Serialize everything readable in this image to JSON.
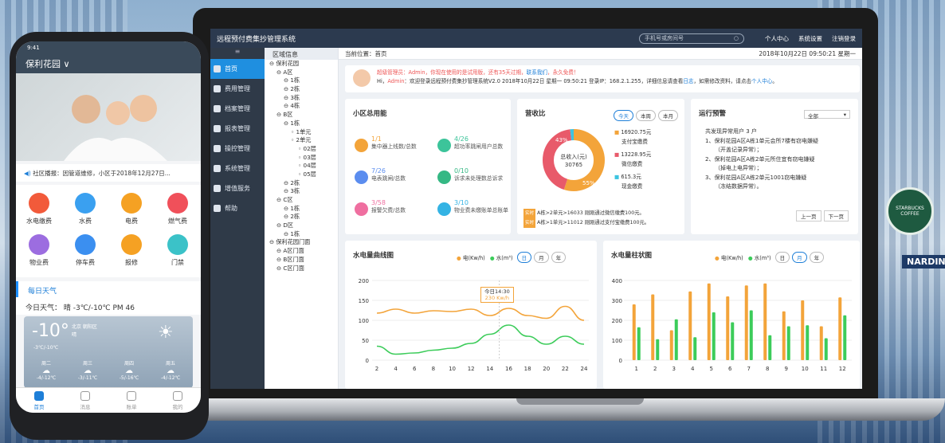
{
  "laptop": {
    "app_title": "远程预付费集抄管理系统",
    "search_placeholder": "手机号或房间号",
    "top_links": [
      "个人中心",
      "系统设置",
      "注销登录"
    ],
    "collapse": "≡",
    "nav": [
      "首页",
      "费用管理",
      "档案管理",
      "报表管理",
      "操控管理",
      "系统管理",
      "增值服务",
      "帮助"
    ],
    "tree_header": "区域信息",
    "tree": [
      "保利花园",
      "A区",
      "1栋",
      "2栋",
      "3栋",
      "4栋",
      "B区",
      "1栋",
      "1单元",
      "2单元",
      "02层",
      "03层",
      "04层",
      "05层",
      "2栋",
      "3栋",
      "C区",
      "1栋",
      "2栋",
      "D区",
      "1栋",
      "保利花园门面",
      "A区门面",
      "B区门面",
      "C区门面"
    ],
    "crumb": "当前位置：首页",
    "datetime": "2018年10月22日    09:50:21    星期一",
    "welcome_line1_a": "超级管理员：Admin，你现在使用的是试用版，还有35天过期，",
    "welcome_line1_b": "联系我们",
    "welcome_line1_c": "，永久免费！",
    "welcome_line2_a": "Hi，",
    "welcome_line2_b": "Admin",
    "welcome_line2_c": "：欢迎登录远程预付费集抄管理系统V2.0    2018年10月22日    星期一    09:50:21    登录IP：168.2.1.255，详细信息请查看",
    "welcome_line2_d": "日志",
    "welcome_line2_e": "，如需修改资料，请点击",
    "welcome_line2_f": "个人中心",
    "welcome_line2_g": "。",
    "energy": {
      "title": "小区总用能",
      "stats": [
        {
          "value": "1/1",
          "label": "集中器上线数/总数",
          "color": "#f3a43a"
        },
        {
          "value": "4/26",
          "label": "超功率跳闸用户总数",
          "color": "#3cc49a"
        },
        {
          "value": "7/26",
          "label": "电表跳闸/总数",
          "color": "#5b8def"
        },
        {
          "value": "0/10",
          "label": "诉求未处理数总诉求",
          "color": "#35b884"
        },
        {
          "value": "3/58",
          "label": "报警欠费/总数",
          "color": "#ef6fa0"
        },
        {
          "value": "3/10",
          "label": "物业费未缴账单总账单",
          "color": "#34b3e4"
        }
      ]
    },
    "revenue": {
      "title": "营收比",
      "tabs": [
        "今天",
        "本周",
        "本月"
      ],
      "center_label": "总收入(元)",
      "center_value": "30765",
      "pct_a": "43%",
      "pct_b": "55%",
      "items": [
        {
          "value": "16920.75元",
          "label": "支付宝缴费",
          "color": "#f3a43a"
        },
        {
          "value": "13228.95元",
          "label": "微信缴费",
          "color": "#e85a6a"
        },
        {
          "value": "615.3元",
          "label": "现金缴费",
          "color": "#3cc4e0"
        }
      ],
      "tag": "实时",
      "news": [
        "A栋>2单元>16033 刚刚通过微信缴费100元。",
        "A栋>1单元>11012 刚刚通过支付宝缴费100元。"
      ]
    },
    "alert": {
      "title": "运行预警",
      "select": "全部",
      "summary": "共发现异常用户 3 户",
      "items": [
        "1、保利花园A区A栋1单元会所7楼有窃电嫌疑",
        "（开盖记录异常）；",
        "2、保利花园A区A栋2单元所住宜有窃电嫌疑",
        "（掉电上电异常）；",
        "3、保利花园A区A栋2单元1001窃电嫌疑",
        "（冻结数据异常）。"
      ],
      "prev": "上一页",
      "next": "下一页"
    },
    "line_chart": {
      "title": "水电量曲线图",
      "legend_e": "电(Kw/h)",
      "legend_w": "水(m³)",
      "tabs": [
        "日",
        "月",
        "年"
      ],
      "tip_time": "今日14:30",
      "tip_value": "230 Kw/h"
    },
    "bar_chart": {
      "title": "水电量柱状图",
      "legend_e": "电(Kw/h)",
      "legend_w": "水(m³)",
      "tabs": [
        "日",
        "月",
        "年"
      ]
    },
    "colors": {
      "electric": "#f3a43a",
      "water": "#3ccc5a",
      "accent": "#1e7fd8"
    }
  },
  "chart_data": [
    {
      "type": "line",
      "title": "水电量曲线图",
      "x": [
        2,
        4,
        6,
        8,
        10,
        12,
        14,
        16,
        18,
        20,
        22,
        24
      ],
      "ylim": [
        0,
        200
      ],
      "yticks": [
        0,
        50,
        100,
        150,
        200
      ],
      "series": [
        {
          "name": "电(Kw/h)",
          "values": [
            118,
            128,
            118,
            124,
            122,
            128,
            112,
            130,
            112,
            105,
            135,
            100
          ]
        },
        {
          "name": "水(m³)",
          "values": [
            35,
            15,
            18,
            25,
            30,
            42,
            65,
            88,
            60,
            40,
            60,
            40
          ]
        }
      ]
    },
    {
      "type": "bar",
      "title": "水电量柱状图",
      "categories": [
        "1",
        "2",
        "3",
        "4",
        "5",
        "6",
        "7",
        "8",
        "9",
        "10",
        "11",
        "12"
      ],
      "ylim": [
        0,
        400
      ],
      "yticks": [
        0,
        100,
        200,
        300,
        400
      ],
      "series": [
        {
          "name": "电(Kw/h)",
          "values": [
            280,
            330,
            150,
            345,
            385,
            320,
            375,
            385,
            245,
            300,
            170,
            315
          ]
        },
        {
          "name": "水(m³)",
          "values": [
            165,
            105,
            205,
            115,
            240,
            190,
            250,
            125,
            170,
            175,
            110,
            225
          ]
        }
      ]
    }
  ],
  "phone": {
    "time": "9:41",
    "community": "保利花园 ∨",
    "notice": "社区播报：因管道维修，小区于2018年12月27日...",
    "services": [
      "水电缴费",
      "水费",
      "电费",
      "燃气费",
      "物业费",
      "停车费",
      "报修",
      "门禁"
    ],
    "service_colors": [
      "#f25a3a",
      "#3aa0f0",
      "#f5a123",
      "#f0505a",
      "#9c6de0",
      "#3b8ff0",
      "#f5a123",
      "#3bc2c8"
    ],
    "weather_title": "每日天气",
    "weather_today": "今日天气：  晴 -3℃/-10℃    PM 46",
    "temp": "-10°",
    "location": "北京 朝阳区",
    "cond": "晴",
    "range": "-3℃/-10℃",
    "days": [
      {
        "d": "周二",
        "t": "-4/-12℃"
      },
      {
        "d": "周三",
        "t": "-3/-11℃"
      },
      {
        "d": "周四",
        "t": "-5/-16℃"
      },
      {
        "d": "周五",
        "t": "-4/-12℃"
      }
    ],
    "tabs": [
      "首页",
      "消息",
      "账单",
      "我的"
    ]
  },
  "bg": {
    "starbucks": "STARBUCKS COFFEE",
    "sign": "NARDIN"
  }
}
